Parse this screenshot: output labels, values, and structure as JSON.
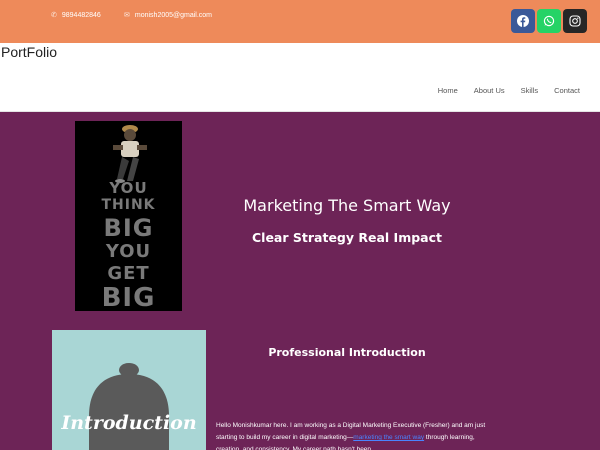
{
  "topbar": {
    "phone": "9894482846",
    "email": "monish2005@gmail.com",
    "social": [
      "facebook-icon",
      "whatsapp-icon",
      "instagram-icon"
    ],
    "color": "#ee8a5a"
  },
  "header": {
    "logo": "PortFolio",
    "nav": [
      "Home",
      "About Us",
      "Skills",
      "Contact"
    ]
  },
  "hero": {
    "image_words": [
      "YOU",
      "THINK",
      "BIG",
      "YOU",
      "GET",
      "BIG"
    ],
    "title": "Marketing The Smart Way",
    "subtitle": "Clear Strategy Real Impact",
    "bg": "#6d2457"
  },
  "intro": {
    "image_text": "Introduction",
    "title": "Professional Introduction",
    "text_before": "Hello Monishkumar here. I am working as a Digital Marketing Executive (Fresher) and am just starting to build my career in digital marketing—",
    "link": "marketing the smart way",
    "text_after": " through learning, creation, and consistency. My career path hasn't been"
  }
}
